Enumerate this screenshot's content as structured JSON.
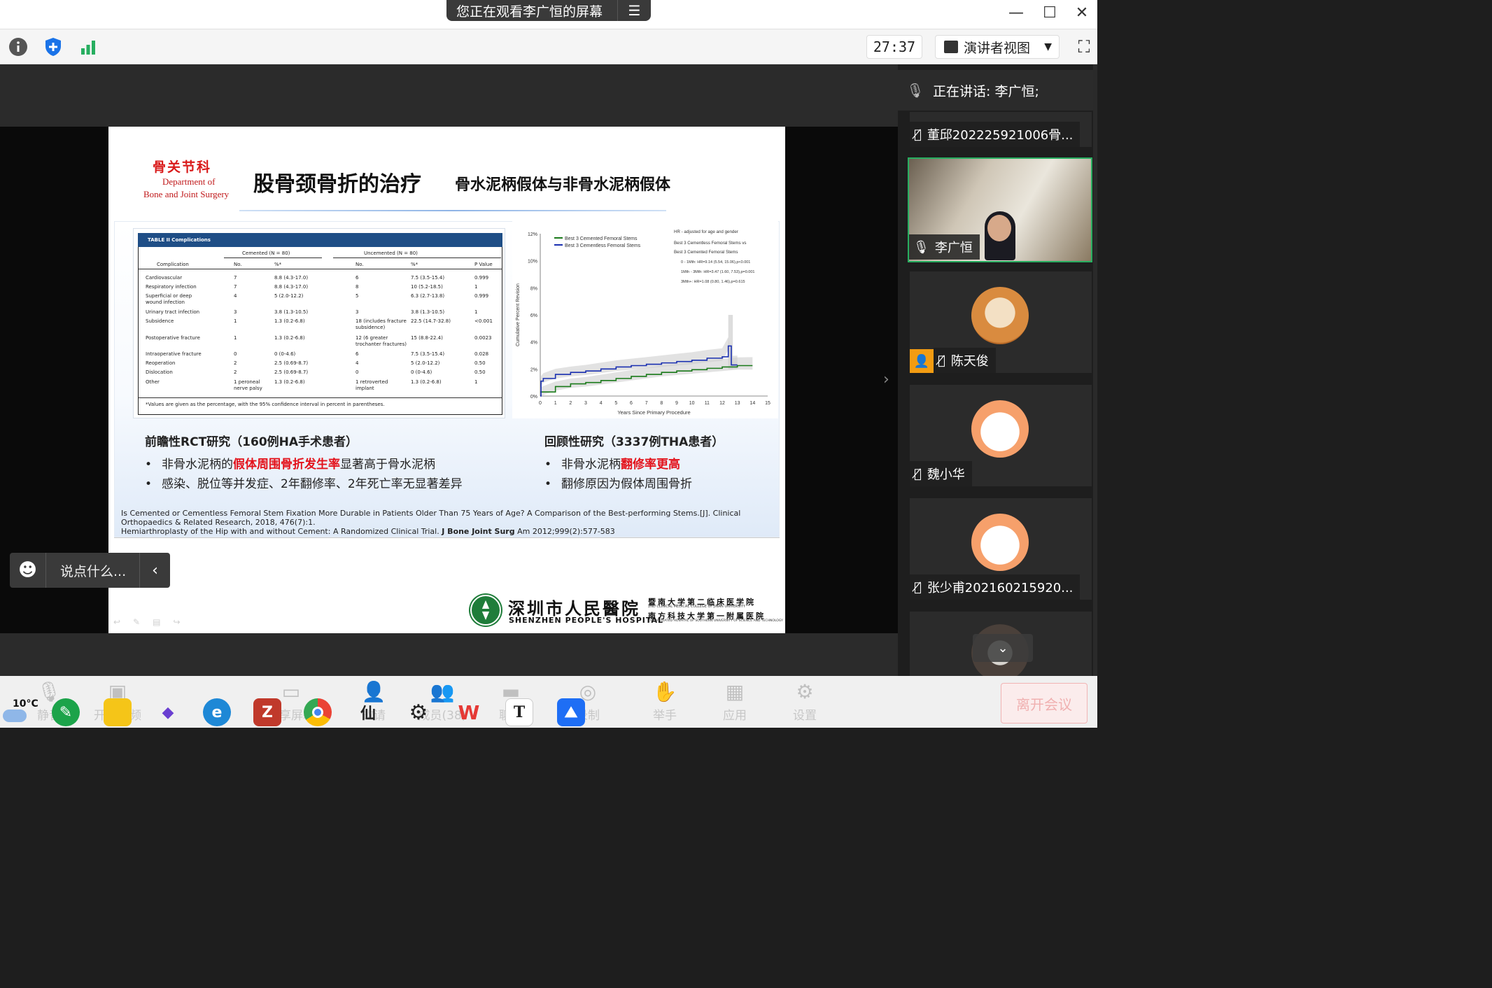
{
  "titlebar": {
    "share_text": "您正在观看李广恒的屏幕",
    "menu_icon": "list-menu-icon",
    "window_controls": [
      "minimize-icon",
      "maximize-icon",
      "close-icon"
    ]
  },
  "toolbar": {
    "left_icons": [
      "info-icon",
      "shield-plus-icon",
      "signal-bars-icon"
    ],
    "timer": "27:37",
    "view_label": "演讲者视图",
    "fullscreen_icon": "fullscreen-icon",
    "accent_green": "#27ae60",
    "accent_blue": "#1a73e8"
  },
  "slide": {
    "dept_cn": "骨关节科",
    "dept_en_line1": "Department of",
    "dept_en_line2": "Bone and Joint Surgery",
    "title": "股骨颈骨折的治疗",
    "subtitle": "骨水泥柄假体与非骨水泥柄假体",
    "table": {
      "caption": "TABLE II Complications",
      "group_headers": [
        "Cemented (N = 80)",
        "Uncemented (N = 80)"
      ],
      "columns": [
        "Complication",
        "No.",
        "%*",
        "No.",
        "%*",
        "P Value"
      ],
      "rows": [
        [
          "Cardiovascular",
          "7",
          "8.8 (4.3-17.0)",
          "6",
          "7.5 (3.5-15.4)",
          "0.999"
        ],
        [
          "Respiratory infection",
          "7",
          "8.8 (4.3-17.0)",
          "8",
          "10 (5.2-18.5)",
          "1"
        ],
        [
          "Superficial or deep\nwound infection",
          "4",
          "5 (2.0-12.2)",
          "5",
          "6.3 (2.7-13.8)",
          "0.999"
        ],
        [
          "Urinary tract infection",
          "3",
          "3.8 (1.3-10.5)",
          "3",
          "3.8 (1.3-10.5)",
          "1"
        ],
        [
          "Subsidence",
          "1",
          "1.3 (0.2-6.8)",
          "18 (includes fracture\nsubsidence)",
          "22.5 (14.7-32.8)",
          "<0.001"
        ],
        [
          "Postoperative fracture",
          "1",
          "1.3 (0.2-6.8)",
          "12 (6 greater\ntrochanter fractures)",
          "15 (8.8-22.4)",
          "0.0023"
        ],
        [
          "Intraoperative fracture",
          "0",
          "0 (0-4.6)",
          "6",
          "7.5 (3.5-15.4)",
          "0.028"
        ],
        [
          "Reoperation",
          "2",
          "2.5 (0.69-8.7)",
          "4",
          "5 (2.0-12.2)",
          "0.50"
        ],
        [
          "Dislocation",
          "2",
          "2.5 (0.69-8.7)",
          "0",
          "0 (0-4.6)",
          "0.50"
        ],
        [
          "Other",
          "1 peroneal\nnerve palsy",
          "1.3 (0.2-6.8)",
          "1 retroverted\nimplant",
          "1.3 (0.2-6.8)",
          "1"
        ]
      ],
      "footnote": "*Values are given as the percentage, with the 95% confidence interval in percent in parentheses."
    },
    "left_heading": "前瞻性RCT研究（160例HA手术患者）",
    "left_bullets": [
      {
        "pre": "非骨水泥柄的",
        "red": "假体周围骨折发生率",
        "post": "显著高于骨水泥柄"
      },
      {
        "pre": "感染、脱位等并发症、2年翻修率、2年死亡率无显著差异",
        "red": "",
        "post": ""
      }
    ],
    "right_heading": "回顾性研究（3337例THA患者）",
    "right_bullets": [
      {
        "pre": "非骨水泥柄",
        "red": "翻修率更高",
        "post": ""
      },
      {
        "pre": "翻修原因为假体周围骨折",
        "red": "",
        "post": ""
      }
    ],
    "ref1": "Is Cemented or Cementless Femoral Stem Fixation More Durable in Patients Older Than 75 Years of Age? A Comparison of the Best-performing Stems.[J]. Clinical Orthopaedics & Related Research, 2018, 476(7):1.",
    "ref2_pre": "Hemiarthroplasty of the Hip with and without Cement: A Randomized Clinical Trial. ",
    "ref2_bold": "J Bone Joint Surg",
    "ref2_post": " Am 2012;999(2):577-583",
    "hospital_cn": "深圳市人民醫院",
    "hospital_en": "SHENZHEN PEOPLE'S HOSPITAL",
    "uni_line1": "暨南大学第二临床医学院",
    "uni_line1_en": "2ND CLINICAL MEDICAL COLLEGE OF JINAN UNIVERSITY",
    "uni_line2": "南方科技大学第一附属医院",
    "uni_line2_en": "1ST AFFILIATED HOSPITAL OF SOUTHERN UNIVERSITY OF SCIENCE AND TECHNOLOGY",
    "chart_hr_lines": [
      "HR - adjusted for age and gender",
      "Best 3 Cementless Femoral Stems vs",
      "Best 3 Cemented Femoral Stems",
      "0 - 1Mth: HR=9.14 (5.54, 15.06),p<0.001",
      "1Mth - 3Mth: HR=3.47 (1.60, 7.53),p=0.001",
      "3Mth+: HR=1.08 (0.80, 1.46),p=0.615"
    ]
  },
  "chart_data": {
    "type": "line",
    "xlabel": "Years Since Primary Procedure",
    "ylabel": "Cumulative Percent Revision",
    "x_ticks": [
      0,
      1,
      2,
      3,
      4,
      5,
      6,
      7,
      8,
      9,
      10,
      11,
      12,
      13,
      14,
      15
    ],
    "y_ticks": [
      "0%",
      "2%",
      "4%",
      "6%",
      "8%",
      "10%",
      "12%"
    ],
    "xlim": [
      0,
      15
    ],
    "ylim": [
      0,
      12
    ],
    "series": [
      {
        "name": "Best 3 Cemented Femoral Stems",
        "color": "#1a7a1a",
        "x": [
          0,
          1,
          2,
          3,
          4,
          5,
          6,
          7,
          8,
          9,
          10,
          11,
          12,
          13,
          14
        ],
        "y": [
          0.3,
          0.7,
          0.9,
          1.0,
          1.15,
          1.3,
          1.45,
          1.6,
          1.75,
          1.85,
          1.95,
          2.05,
          2.15,
          2.25,
          2.25
        ]
      },
      {
        "name": "Best 3 Cementless Femoral Stems",
        "color": "#1a2fb0",
        "x": [
          0,
          0.05,
          0.2,
          1,
          2,
          3,
          4,
          5,
          6,
          7,
          8,
          9,
          10,
          11,
          12,
          12.4,
          12.6,
          13
        ],
        "y": [
          0,
          1.1,
          1.3,
          1.6,
          1.75,
          1.85,
          2.0,
          2.15,
          2.25,
          2.35,
          2.45,
          2.55,
          2.65,
          2.8,
          2.9,
          3.7,
          2.3,
          2.3
        ]
      }
    ],
    "legend": "top-left"
  },
  "chat": {
    "placeholder": "说点什么...",
    "smile_icon": "smile-icon",
    "collapse_icon": "chevron-left-icon"
  },
  "panel": {
    "speaking_label": "正在讲话: 李广恒;",
    "participants": [
      {
        "name": "董邱202225921006骨...",
        "muted": true
      },
      {
        "name": "李广恒",
        "muted": false,
        "video": true
      },
      {
        "name": "陈天俊",
        "muted": true,
        "avatar": "shiba-avatar"
      },
      {
        "name": "魏小华",
        "muted": true,
        "avatar": "bunny-avatar"
      },
      {
        "name": "张少甫202160215920...",
        "muted": true,
        "avatar": "bunny-avatar"
      },
      {
        "name": "",
        "avatar": "cat-avatar"
      }
    ]
  },
  "controls": {
    "items": [
      "静音",
      "开始视频",
      "共享屏幕",
      "邀请",
      "成员(38)",
      "聊天",
      "录制",
      "举手",
      "应用",
      "设置"
    ],
    "leave": "离开会议"
  },
  "taskbar": {
    "temperature": "10°C"
  }
}
